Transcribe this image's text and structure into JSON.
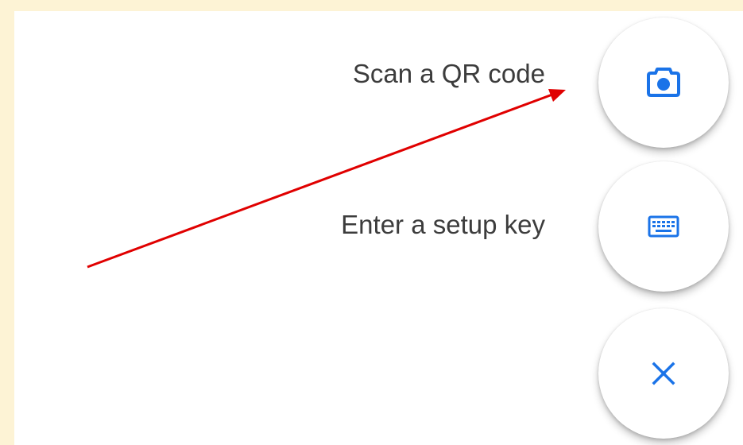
{
  "speed_dial": {
    "scan_qr": {
      "label": "Scan a QR code",
      "icon": "camera-icon"
    },
    "setup_key": {
      "label": "Enter a setup key",
      "icon": "keyboard-icon"
    },
    "close": {
      "icon": "close-icon"
    }
  },
  "colors": {
    "background": "#fdf3d5",
    "accent": "#1a73e8",
    "annotation_arrow": "#e00000"
  }
}
